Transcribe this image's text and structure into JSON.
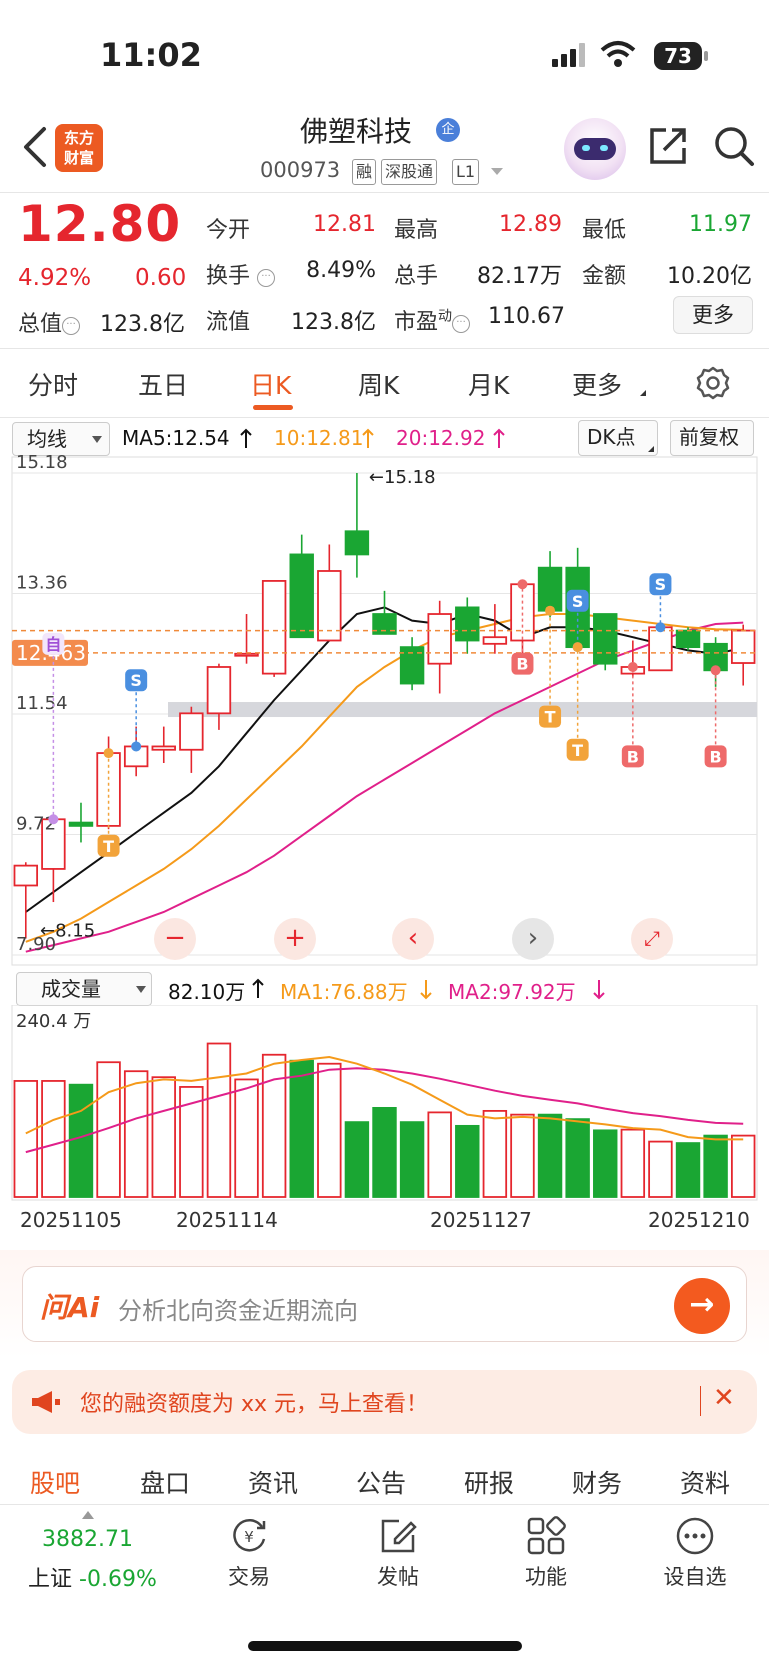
{
  "status_bar": {
    "time": "11:02",
    "battery": "73"
  },
  "header": {
    "back_icon": "chevron-left-icon",
    "brand_logo": "东方财富",
    "brand_line1": "东方",
    "brand_line2": "财富",
    "stock_name": "佛塑科技",
    "name_badge": "企",
    "stock_code": "000973",
    "tags": [
      "融",
      "深股通",
      "L1"
    ],
    "share_icon": "share-icon",
    "search_icon": "search-icon"
  },
  "quote": {
    "price": "12.80",
    "change_pct": "4.92%",
    "change": "0.60",
    "fields": {
      "open_label": "今开",
      "open": "12.81",
      "high_label": "最高",
      "high": "12.89",
      "low_label": "最低",
      "low": "11.97",
      "turnover_label": "换手",
      "turnover": "8.49%",
      "volume_label": "总手",
      "volume": "82.17万",
      "amount_label": "金额",
      "amount": "10.20亿",
      "mktcap_label": "总值",
      "mktcap": "123.8亿",
      "float_label": "流值",
      "float": "123.8亿",
      "pe_label": "市盈",
      "pe_sup": "动",
      "pe": "110.67"
    },
    "more_label": "更多"
  },
  "period_tabs": [
    "分时",
    "五日",
    "日K",
    "周K",
    "月K",
    "更多"
  ],
  "period_active": "日K",
  "chart_toolbar": {
    "indicator_select": "均线",
    "ma5": "MA5:12.54",
    "ma10": "10:12.81",
    "ma20": "20:12.92",
    "dk_label": "DK点",
    "adjust_label": "前复权"
  },
  "colors": {
    "up": "#e5262e",
    "down": "#1aa633",
    "accent": "#ec5a22",
    "ma5": "#111111",
    "ma10": "#f59a1a",
    "ma20": "#e0208a"
  },
  "chart_data": {
    "type": "candlestick",
    "y_labels": [
      "15.18",
      "13.36",
      "11.54",
      "9.72",
      "7.90"
    ],
    "ylim": [
      7.9,
      15.18
    ],
    "price_line_label": "12.463",
    "max_marker": "15.18",
    "min_marker": "8.15",
    "candles": [
      {
        "o": 8.95,
        "h": 9.3,
        "l": 8.15,
        "c": 9.25
      },
      {
        "o": 9.2,
        "h": 10.0,
        "l": 8.7,
        "c": 9.95
      },
      {
        "o": 9.9,
        "h": 10.2,
        "l": 9.6,
        "c": 9.85
      },
      {
        "o": 9.85,
        "h": 11.2,
        "l": 9.8,
        "c": 10.95
      },
      {
        "o": 10.75,
        "h": 11.35,
        "l": 10.6,
        "c": 11.05
      },
      {
        "o": 11.0,
        "h": 11.35,
        "l": 10.8,
        "c": 11.05
      },
      {
        "o": 11.0,
        "h": 11.65,
        "l": 10.65,
        "c": 11.55
      },
      {
        "o": 11.55,
        "h": 12.3,
        "l": 11.3,
        "c": 12.25
      },
      {
        "o": 12.45,
        "h": 13.05,
        "l": 12.3,
        "c": 12.45
      },
      {
        "o": 12.15,
        "h": 13.55,
        "l": 12.1,
        "c": 13.55
      },
      {
        "o": 13.95,
        "h": 14.25,
        "l": 12.7,
        "c": 12.7
      },
      {
        "o": 12.65,
        "h": 14.1,
        "l": 12.65,
        "c": 13.7
      },
      {
        "o": 14.3,
        "h": 15.18,
        "l": 13.6,
        "c": 13.95
      },
      {
        "o": 13.05,
        "h": 13.4,
        "l": 12.75,
        "c": 12.75
      },
      {
        "o": 12.55,
        "h": 12.7,
        "l": 11.9,
        "c": 12.0
      },
      {
        "o": 12.3,
        "h": 13.25,
        "l": 11.85,
        "c": 13.05
      },
      {
        "o": 13.15,
        "h": 13.3,
        "l": 12.45,
        "c": 12.65
      },
      {
        "o": 12.6,
        "h": 13.2,
        "l": 12.45,
        "c": 12.7
      },
      {
        "o": 12.65,
        "h": 13.5,
        "l": 12.35,
        "c": 13.5
      },
      {
        "o": 13.75,
        "h": 14.0,
        "l": 13.0,
        "c": 13.1
      },
      {
        "o": 13.75,
        "h": 14.05,
        "l": 12.5,
        "c": 12.55
      },
      {
        "o": 13.05,
        "h": 13.05,
        "l": 12.2,
        "c": 12.3
      },
      {
        "o": 12.15,
        "h": 12.65,
        "l": 12.1,
        "c": 12.25
      },
      {
        "o": 12.2,
        "h": 12.85,
        "l": 12.2,
        "c": 12.85
      },
      {
        "o": 12.8,
        "h": 12.85,
        "l": 12.5,
        "c": 12.55
      },
      {
        "o": 12.6,
        "h": 12.7,
        "l": 11.95,
        "c": 12.2
      },
      {
        "o": 12.31,
        "h": 12.89,
        "l": 11.97,
        "c": 12.8
      }
    ],
    "ma5": [
      8.55,
      8.85,
      9.15,
      9.45,
      9.75,
      10.05,
      10.35,
      10.75,
      11.25,
      11.75,
      12.2,
      12.65,
      13.05,
      13.15,
      12.95,
      12.9,
      13.05,
      12.95,
      12.7,
      12.85,
      12.85,
      12.8,
      12.7,
      12.6,
      12.5,
      12.45,
      12.54
    ],
    "ma10": [
      8.1,
      8.25,
      8.45,
      8.7,
      8.95,
      9.2,
      9.5,
      9.85,
      10.25,
      10.65,
      11.05,
      11.5,
      11.95,
      12.25,
      12.5,
      12.7,
      12.8,
      12.9,
      13.0,
      13.05,
      13.05,
      13.0,
      12.95,
      12.9,
      12.85,
      12.82,
      12.81
    ],
    "ma20": [
      7.95,
      8.05,
      8.15,
      8.25,
      8.4,
      8.55,
      8.75,
      8.95,
      9.15,
      9.4,
      9.7,
      10.0,
      10.3,
      10.55,
      10.8,
      11.05,
      11.3,
      11.55,
      11.75,
      11.95,
      12.15,
      12.35,
      12.5,
      12.65,
      12.8,
      12.9,
      12.92
    ],
    "signals": [
      {
        "i": 1,
        "label": "自",
        "price": 12.6
      },
      {
        "i": 4,
        "label": "S",
        "price": 12.05
      },
      {
        "i": 20,
        "label": "S",
        "price": 13.25
      },
      {
        "i": 23,
        "label": "S",
        "price": 13.5
      },
      {
        "i": 18,
        "label": "B",
        "price": 12.3
      },
      {
        "i": 22,
        "label": "B",
        "price": 10.9
      },
      {
        "i": 25,
        "label": "B",
        "price": 10.9
      },
      {
        "i": 19,
        "label": "T",
        "price": 11.5
      },
      {
        "i": 20,
        "label": "T",
        "price": 11.0
      },
      {
        "i": 3,
        "label": "T",
        "price": 9.55
      }
    ]
  },
  "chart_controls": [
    "zoom-out-button",
    "zoom-in-button",
    "scroll-left-button",
    "scroll-right-button",
    "fullscreen-button"
  ],
  "volume_toolbar": {
    "indicator_select": "成交量",
    "vol": "82.10万",
    "ma1": "MA1:76.88万",
    "ma2": "MA2:97.92万"
  },
  "volume_data": {
    "max_label": "240.4 万",
    "values": [
      155,
      155,
      150,
      180,
      168,
      160,
      147,
      205,
      157,
      190,
      182,
      178,
      100,
      119,
      100,
      113,
      95,
      115,
      110,
      110,
      104,
      89,
      90,
      74,
      72,
      82,
      82
    ],
    "ma1": [
      85,
      103,
      115,
      140,
      152,
      157,
      155,
      160,
      165,
      178,
      183,
      187,
      178,
      165,
      150,
      130,
      110,
      105,
      107,
      105,
      101,
      97,
      92,
      90,
      80,
      76.88,
      76.88
    ],
    "ma2": [
      60,
      70,
      80,
      92,
      105,
      115,
      125,
      135,
      145,
      157,
      162,
      170,
      172,
      170,
      165,
      158,
      150,
      142,
      135,
      130,
      125,
      118,
      112,
      108,
      103,
      99,
      97.92
    ]
  },
  "dates": [
    "20251105",
    "20251114",
    "20251127",
    "20251210"
  ],
  "ai_bar": {
    "logo": "问Ai",
    "placeholder": "分析北向资金近期流向"
  },
  "notice": {
    "text": "您的融资额度为 xx 元，马上查看！"
  },
  "bottom_tabs": [
    "股吧",
    "盘口",
    "资讯",
    "公告",
    "研报",
    "财务",
    "资料"
  ],
  "bottom_tab_active": "股吧",
  "bottom_nav": {
    "index_value": "3882.71",
    "index_name": "上证",
    "index_change": "-0.69%",
    "items": [
      "交易",
      "发帖",
      "功能",
      "设自选"
    ]
  }
}
